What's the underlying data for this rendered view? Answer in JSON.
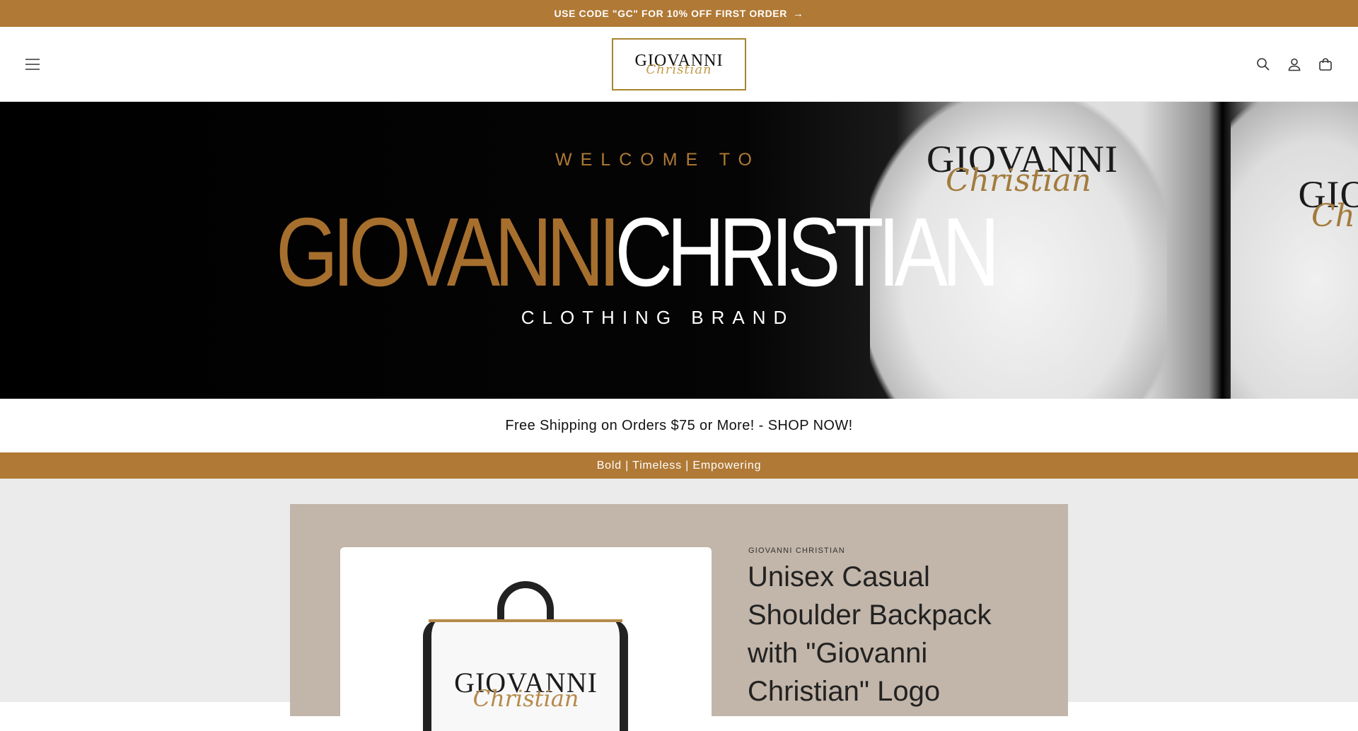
{
  "announcement": {
    "text": "USE CODE \"GC\" FOR 10% OFF FIRST ORDER",
    "arrow": "→"
  },
  "header": {
    "menu_icon": "menu-icon",
    "logo": {
      "line1": "GIOVANNI",
      "line2": "Christian"
    },
    "icons": [
      "search-icon",
      "account-icon",
      "cart-icon"
    ]
  },
  "hero": {
    "welcome": "WELCOME TO",
    "brand_gold": "GIOVANNI",
    "brand_white": "CHRISTIAN",
    "subtitle": "CLOTHING BRAND",
    "tee1_logo": {
      "line1": "GIOVANNI",
      "line2": "Christian"
    },
    "tee2_logo": {
      "line1": "GIO",
      "line2": "Ch"
    }
  },
  "shipping_text": "Free Shipping on Orders $75 or More! - SHOP NOW!",
  "tagline": "Bold | Timeless | Empowering",
  "product": {
    "vendor": "GIOVANNI CHRISTIAN",
    "title": "Unisex Casual Shoulder Backpack with \"Giovanni Christian\" Logo",
    "image_logo": {
      "line1": "GIOVANNI",
      "line2": "Christian"
    }
  },
  "colors": {
    "accent": "#b07935",
    "card": "#c2b5a9",
    "page_bg": "#ebebeb"
  }
}
